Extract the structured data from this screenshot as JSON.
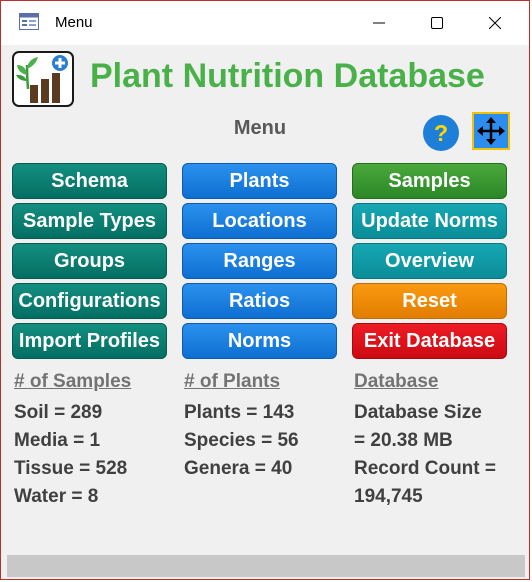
{
  "window": {
    "title": "Menu"
  },
  "header": {
    "app_title": "Plant Nutrition Database",
    "menu_label": "Menu",
    "help_symbol": "?"
  },
  "buttons": {
    "col1": [
      "Schema",
      "Sample Types",
      "Groups",
      "Configurations",
      "Import Profiles"
    ],
    "col2": [
      "Plants",
      "Locations",
      "Ranges",
      "Ratios",
      "Norms"
    ],
    "col3": [
      "Samples",
      "Update Norms",
      "Overview",
      "Reset",
      "Exit Database"
    ]
  },
  "stats": {
    "samples": {
      "heading": "# of Samples",
      "lines": [
        "Soil = 289",
        "Media = 1",
        "Tissue = 528",
        "Water = 8"
      ]
    },
    "plants": {
      "heading": "# of Plants",
      "lines": [
        "Plants = 143",
        "Species = 56",
        "Genera = 40"
      ]
    },
    "database": {
      "heading": "Database",
      "lines": [
        "Database Size",
        "= 20.38 MB",
        "Record Count =",
        "194,745"
      ]
    }
  },
  "icons": [
    "form-icon",
    "minimize-icon",
    "maximize-icon",
    "close-icon",
    "plant-growth-logo-icon",
    "help-icon",
    "move-arrows-icon"
  ],
  "colors": {
    "title_green": "#4ab14a",
    "dark_teal": "#0a7f72",
    "blue": "#1a7fe0",
    "green": "#3a9832",
    "light_teal": "#109aa6",
    "orange": "#f08c00",
    "red": "#dd1219"
  }
}
